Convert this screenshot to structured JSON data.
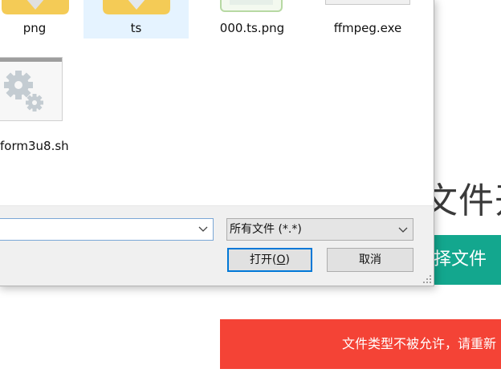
{
  "dialog": {
    "files": [
      {
        "name": "png",
        "icon": "folder-icon",
        "selected": false
      },
      {
        "name": "ts",
        "icon": "folder-icon",
        "selected": true
      },
      {
        "name": "000.ts.png",
        "icon": "image-file-icon",
        "selected": false
      },
      {
        "name": "ffmpeg.exe",
        "icon": "exe-file-icon",
        "selected": false
      },
      {
        "name": "form3u8.sh",
        "icon": "script-file-icon",
        "selected": false
      }
    ],
    "filename_value": "",
    "filetype_selected": "所有文件 (*.*)",
    "open_label": "打开(",
    "open_accel": "O",
    "open_label_end": ")",
    "cancel_label": "取消"
  },
  "page": {
    "heading_fragment": "文件开",
    "select_button_fragment": "择文件",
    "error_message_fragment": "文件类型不被允许，请重新"
  },
  "colors": {
    "select_button": "#13a78e",
    "error_banner": "#f44336",
    "selection_highlight": "#e5f3ff",
    "default_button_border": "#0078d7"
  }
}
